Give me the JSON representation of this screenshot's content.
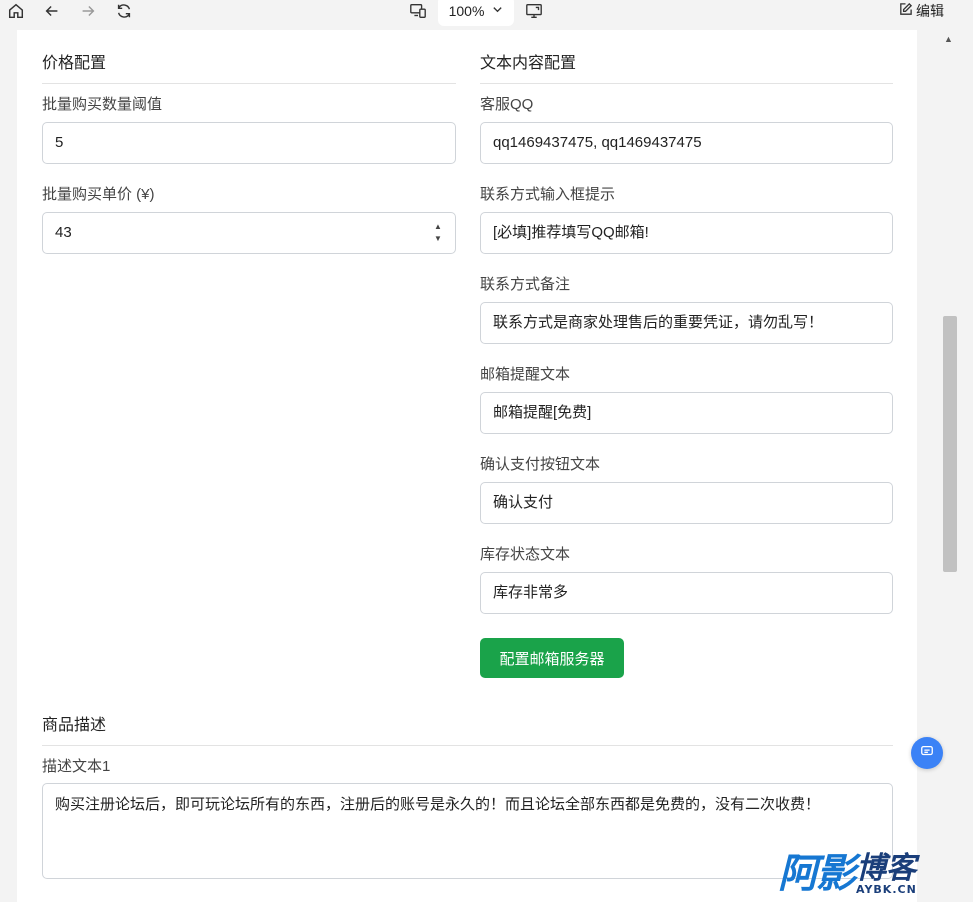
{
  "toolbar": {
    "zoom": "100%",
    "edit_label": "编辑"
  },
  "left": {
    "section_title": "价格配置",
    "fields": [
      {
        "label": "批量购买数量阈值",
        "value": "5"
      },
      {
        "label": "批量购买单价 (¥)",
        "value": "43"
      }
    ]
  },
  "right": {
    "section_title": "文本内容配置",
    "fields": [
      {
        "label": "客服QQ",
        "value": "qq1469437475, qq1469437475"
      },
      {
        "label": "联系方式输入框提示",
        "value": "[必填]推荐填写QQ邮箱!"
      },
      {
        "label": "联系方式备注",
        "value": "联系方式是商家处理售后的重要凭证，请勿乱写！"
      },
      {
        "label": "邮箱提醒文本",
        "value": "邮箱提醒[免费]"
      },
      {
        "label": "确认支付按钮文本",
        "value": "确认支付"
      },
      {
        "label": "库存状态文本",
        "value": "库存非常多"
      }
    ],
    "button_label": "配置邮箱服务器"
  },
  "description": {
    "section_title": "商品描述",
    "label": "描述文本1",
    "value": "购买注册论坛后，即可玩论坛所有的东西，注册后的账号是永久的！而且论坛全部东西都是免费的，没有二次收费！"
  },
  "watermark": {
    "main": "阿影",
    "cn": "博客",
    "en": "AYBK.CN"
  },
  "colors": {
    "primary_button": "#1aa34a",
    "chat_fab": "#3b82f6",
    "watermark_blue": "#1677d2"
  }
}
